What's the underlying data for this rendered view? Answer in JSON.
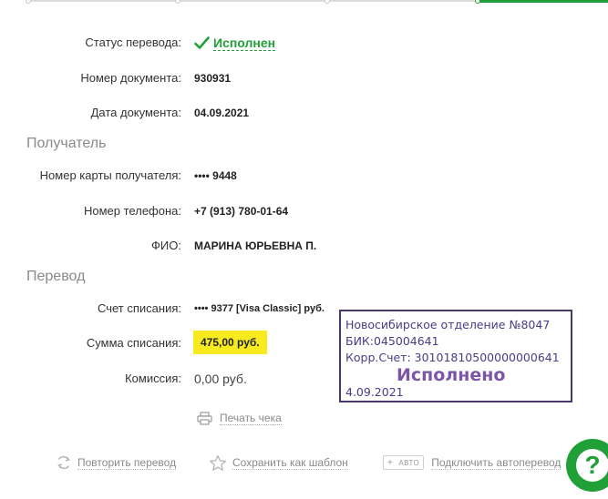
{
  "status": {
    "label": "Статус перевода:",
    "value": "Исполнен"
  },
  "document": {
    "number_label": "Номер документа:",
    "number": "930931",
    "date_label": "Дата документа:",
    "date": "04.09.2021"
  },
  "recipient": {
    "section": "Получатель",
    "card_label": "Номер карты получателя:",
    "card": "•••• 9448",
    "phone_label": "Номер телефона:",
    "phone": "+7 (913) 780-01-64",
    "name_label": "ФИО:",
    "name": "МАРИНА ЮРЬЕВНА П."
  },
  "transfer": {
    "section": "Перевод",
    "account_label": "Счет списания:",
    "account": "•••• 9377  [Visa Classic]  руб.",
    "amount_label": "Сумма списания:",
    "amount": "475,00  руб.",
    "fee_label": "Комиссия:",
    "fee": "0,00 руб."
  },
  "print_label": "Печать чека",
  "actions": {
    "repeat": "Повторить перевод",
    "save_template": "Сохранить как шаблон",
    "auto_badge": "АВТО",
    "auto_badge_plus": "+",
    "autopay": "Подключить автоперевод"
  },
  "stamp": {
    "line1": "Новосибирское отделение №8047",
    "line2": "БИК:045004641",
    "line3": "Корр.Счет: 30101810500000000641",
    "status": "Исполнено",
    "date": "4.09.2021"
  },
  "help_symbol": "?",
  "colors": {
    "brand_green": "#21a038",
    "highlight_yellow": "#f7ea1f",
    "stamp_purple": "#4b3a8c"
  },
  "icons": [
    "check-icon",
    "printer-icon",
    "repeat-icon",
    "star-icon",
    "question-icon"
  ]
}
